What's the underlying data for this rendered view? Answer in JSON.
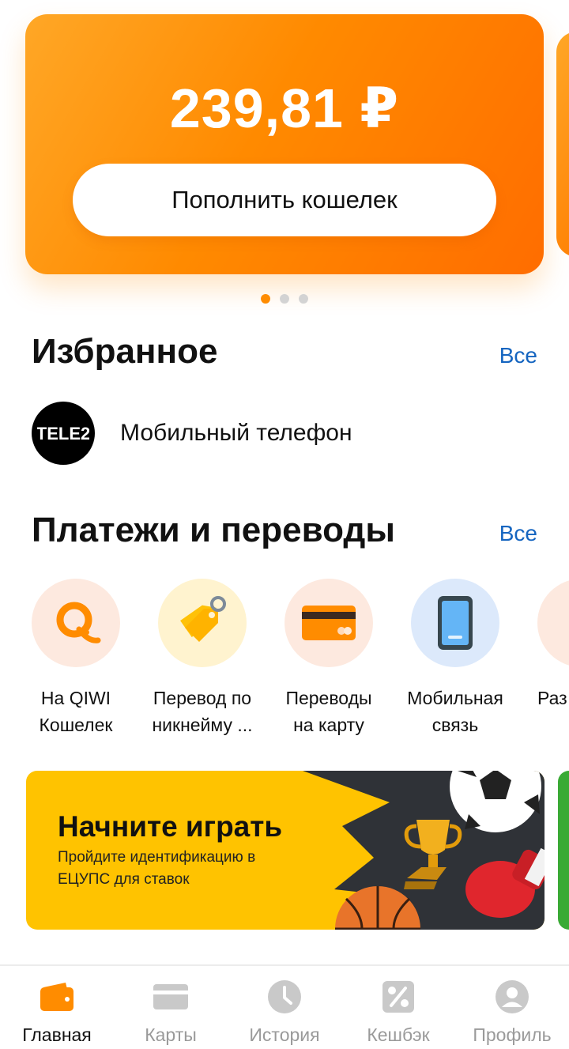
{
  "balance": {
    "amount": "239,81 ₽",
    "topup_label": "Пополнить кошелек",
    "carousel_pages": 3,
    "active_page": 1
  },
  "favorites": {
    "title": "Избранное",
    "see_all": "Все",
    "items": [
      {
        "label": "Мобильный телефон",
        "logo_text": "TELE2",
        "icon": "tele2-logo"
      }
    ]
  },
  "payments": {
    "title": "Платежи и переводы",
    "see_all": "Все",
    "items": [
      {
        "line1": "На QIWI",
        "line2": "Кошелек",
        "icon": "qiwi-icon"
      },
      {
        "line1": "Перевод по",
        "line2": "никнейму ...",
        "icon": "price-tag-icon"
      },
      {
        "line1": "Переводы",
        "line2": "на карту",
        "icon": "bank-card-icon"
      },
      {
        "line1": "Мобильная",
        "line2": "связь",
        "icon": "smartphone-icon"
      },
      {
        "line1": "Раз",
        "line2": "",
        "icon": "trophy-icon"
      }
    ]
  },
  "promo": {
    "title": "Начните играть",
    "subtitle": "Пройдите идентификацию в ЕЦУПС для ставок"
  },
  "nav": {
    "items": [
      {
        "label": "Главная",
        "icon": "wallet-icon",
        "active": true
      },
      {
        "label": "Карты",
        "icon": "card-icon",
        "active": false
      },
      {
        "label": "История",
        "icon": "clock-icon",
        "active": false
      },
      {
        "label": "Кешбэк",
        "icon": "percent-icon",
        "active": false
      },
      {
        "label": "Профиль",
        "icon": "profile-icon",
        "active": false
      }
    ]
  },
  "colors": {
    "accent": "#ff8c00",
    "link": "#1565c0",
    "promo_bg": "#ffc300",
    "nav_inactive": "#9a9a9a"
  }
}
